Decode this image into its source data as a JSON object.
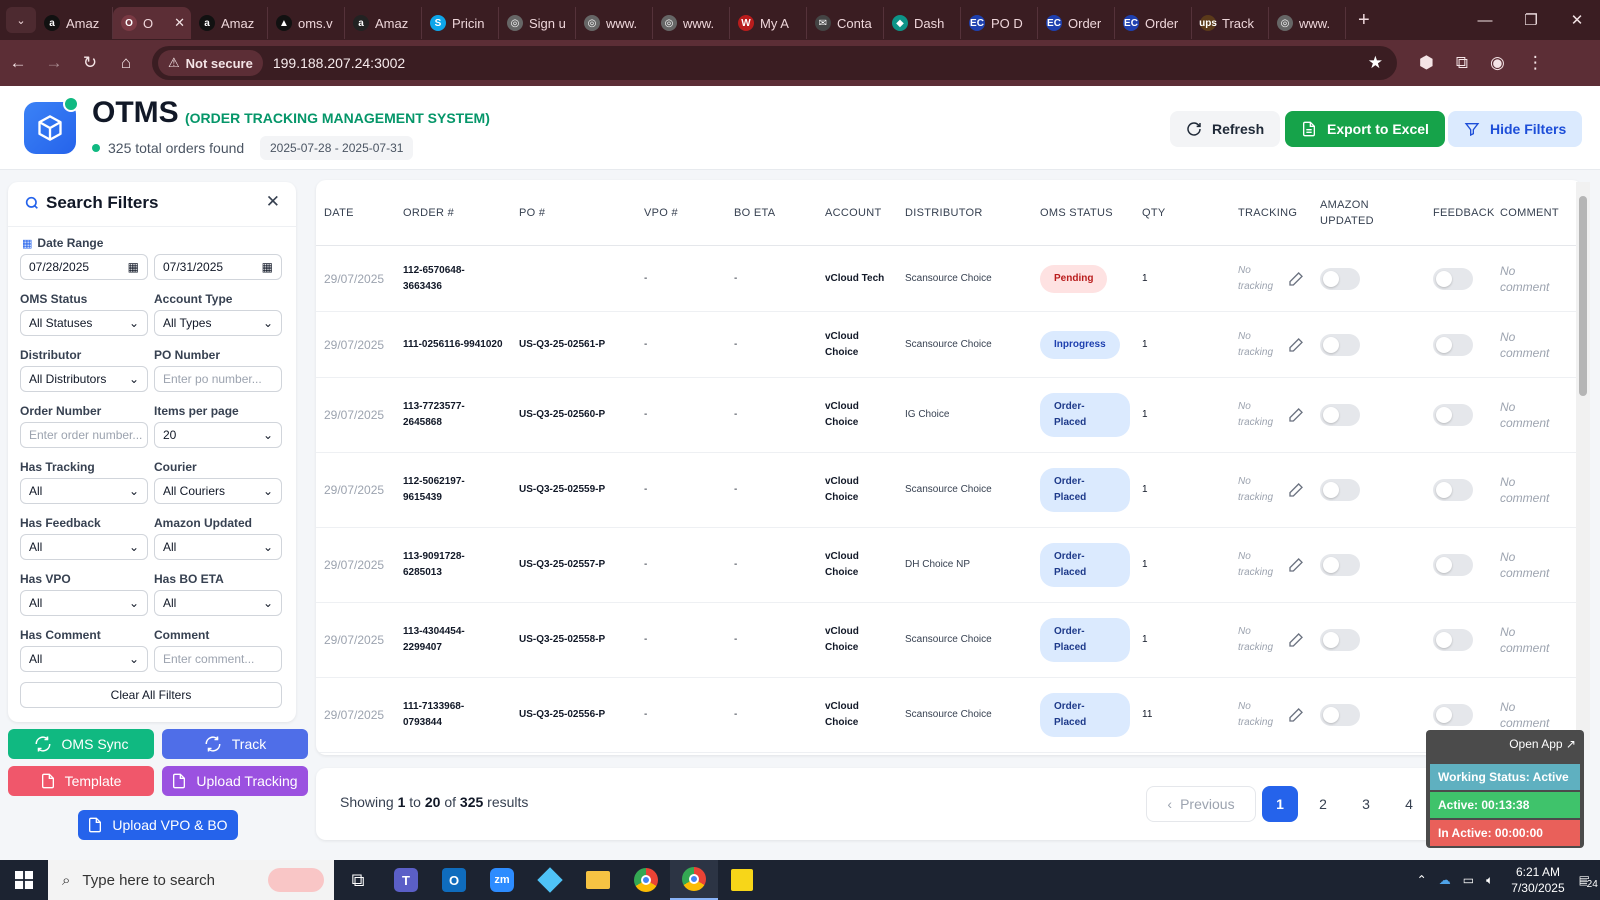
{
  "browser": {
    "tabs": [
      {
        "title": "Amaz",
        "fav": "a",
        "color": "#111"
      },
      {
        "title": "O",
        "fav": "O",
        "color": "#7a3a44",
        "active": true
      },
      {
        "title": "Amaz",
        "fav": "a",
        "color": "#111"
      },
      {
        "title": "oms.v",
        "fav": "▲",
        "color": "#111"
      },
      {
        "title": "Amaz",
        "fav": "a",
        "color": "#222"
      },
      {
        "title": "Pricin",
        "fav": "S",
        "color": "#0ea5e9"
      },
      {
        "title": "Sign u",
        "fav": "◎",
        "color": "#666"
      },
      {
        "title": "www.",
        "fav": "◎",
        "color": "#666"
      },
      {
        "title": "www.",
        "fav": "◎",
        "color": "#666"
      },
      {
        "title": "My A",
        "fav": "W",
        "color": "#b91c1c"
      },
      {
        "title": "Conta",
        "fav": "✉",
        "color": "#444"
      },
      {
        "title": "Dash",
        "fav": "◆",
        "color": "#0d9488"
      },
      {
        "title": "PO D",
        "fav": "EC",
        "color": "#1e40af"
      },
      {
        "title": "Order",
        "fav": "EC",
        "color": "#1e40af"
      },
      {
        "title": "Order",
        "fav": "EC",
        "color": "#1e40af"
      },
      {
        "title": "Track",
        "fav": "ups",
        "color": "#5b3a1a"
      },
      {
        "title": "www.",
        "fav": "◎",
        "color": "#666"
      }
    ],
    "url": "199.188.207.24:3002",
    "security_label": "Not secure"
  },
  "header": {
    "brand": "OTMS",
    "brand_sub": "(ORDER TRACKING MANAGEMENT SYSTEM)",
    "total": "325 total orders found",
    "date_range": "2025-07-28 - 2025-07-31",
    "refresh_label": "Refresh",
    "export_label": "Export to Excel",
    "hide_filters_label": "Hide Filters"
  },
  "filters": {
    "title": "Search Filters",
    "date_range_label": "Date Range",
    "date_from": "07/28/2025",
    "date_to": "07/31/2025",
    "oms_status_label": "OMS Status",
    "oms_status_value": "All Statuses",
    "account_type_label": "Account Type",
    "account_type_value": "All Types",
    "distributor_label": "Distributor",
    "distributor_value": "All Distributors",
    "po_number_label": "PO Number",
    "po_number_placeholder": "Enter po number...",
    "order_number_label": "Order Number",
    "order_number_placeholder": "Enter order number...",
    "items_per_page_label": "Items per page",
    "items_per_page_value": "20",
    "has_tracking_label": "Has Tracking",
    "has_tracking_value": "All",
    "courier_label": "Courier",
    "courier_value": "All Couriers",
    "has_feedback_label": "Has Feedback",
    "has_feedback_value": "All",
    "amazon_updated_label": "Amazon Updated",
    "amazon_updated_value": "All",
    "has_vpo_label": "Has VPO",
    "has_vpo_value": "All",
    "has_bo_eta_label": "Has BO ETA",
    "has_bo_eta_value": "All",
    "has_comment_label": "Has Comment",
    "has_comment_value": "All",
    "comment_label": "Comment",
    "comment_placeholder": "Enter comment...",
    "clear_label": "Clear All Filters"
  },
  "actions": {
    "oms_sync": "OMS Sync",
    "track": "Track",
    "template": "Template",
    "upload_tracking": "Upload Tracking",
    "upload_vpo_bo": "Upload VPO & BO"
  },
  "table": {
    "headers": {
      "date": "DATE",
      "order": "ORDER #",
      "po": "PO #",
      "vpo": "VPO #",
      "bo_eta": "BO ETA",
      "account": "ACCOUNT",
      "distributor": "DISTRIBUTOR",
      "oms_status": "OMS STATUS",
      "qty": "QTY",
      "tracking": "TRACKING",
      "amazon_updated": "AMAZON UPDATED",
      "feedback": "FEEDBACK",
      "comment": "COMMENT"
    },
    "rows": [
      {
        "date": "29/07/2025",
        "order": "112-6570648-3663436",
        "po": "",
        "vpo": "-",
        "bo_eta": "-",
        "account": "vCloud Tech",
        "distributor": "Scansource Choice",
        "status": "Pending",
        "status_kind": "pending",
        "qty": "1",
        "tracking": "No tracking",
        "comment": "No comment"
      },
      {
        "date": "29/07/2025",
        "order": "111-0256116-9941020",
        "po": "US-Q3-25-02561-P",
        "vpo": "-",
        "bo_eta": "-",
        "account": "vCloud Choice",
        "distributor": "Scansource Choice",
        "status": "Inprogress",
        "status_kind": "inprog",
        "qty": "1",
        "tracking": "No tracking",
        "comment": "No comment"
      },
      {
        "date": "29/07/2025",
        "order": "113-7723577-2645868",
        "po": "US-Q3-25-02560-P",
        "vpo": "-",
        "bo_eta": "-",
        "account": "vCloud Choice",
        "distributor": "IG Choice",
        "status": "Order-Placed",
        "status_kind": "placed",
        "qty": "1",
        "tracking": "No tracking",
        "comment": "No comment"
      },
      {
        "date": "29/07/2025",
        "order": "112-5062197-9615439",
        "po": "US-Q3-25-02559-P",
        "vpo": "-",
        "bo_eta": "-",
        "account": "vCloud Choice",
        "distributor": "Scansource Choice",
        "status": "Order-Placed",
        "status_kind": "placed",
        "qty": "1",
        "tracking": "No tracking",
        "comment": "No comment"
      },
      {
        "date": "29/07/2025",
        "order": "113-9091728-6285013",
        "po": "US-Q3-25-02557-P",
        "vpo": "-",
        "bo_eta": "-",
        "account": "vCloud Choice",
        "distributor": "DH Choice NP",
        "status": "Order-Placed",
        "status_kind": "placed",
        "qty": "1",
        "tracking": "No tracking",
        "comment": "No comment"
      },
      {
        "date": "29/07/2025",
        "order": "113-4304454-2299407",
        "po": "US-Q3-25-02558-P",
        "vpo": "-",
        "bo_eta": "-",
        "account": "vCloud Choice",
        "distributor": "Scansource Choice",
        "status": "Order-Placed",
        "status_kind": "placed",
        "qty": "1",
        "tracking": "No tracking",
        "comment": "No comment"
      },
      {
        "date": "29/07/2025",
        "order": "111-7133968-0793844",
        "po": "US-Q3-25-02556-P",
        "vpo": "-",
        "bo_eta": "-",
        "account": "vCloud Choice",
        "distributor": "Scansource Choice",
        "status": "Order-Placed",
        "status_kind": "placed",
        "qty": "11",
        "tracking": "No tracking",
        "comment": "No comment"
      }
    ]
  },
  "pagination": {
    "showing_prefix": "Showing",
    "from": "1",
    "to_word": "to",
    "to": "20",
    "of_word": "of",
    "total": "325",
    "results_word": "results",
    "previous_label": "Previous",
    "pages": [
      "1",
      "2",
      "3",
      "4"
    ],
    "current": "1"
  },
  "widget": {
    "open_app": "Open App ↗",
    "working_status": "Working Status: Active",
    "active": "Active: 00:13:38",
    "inactive": "In Active: 00:00:00"
  },
  "taskbar": {
    "search_placeholder": "Type here to search",
    "time": "6:21 AM",
    "date": "7/30/2025",
    "notif_count": "24"
  }
}
